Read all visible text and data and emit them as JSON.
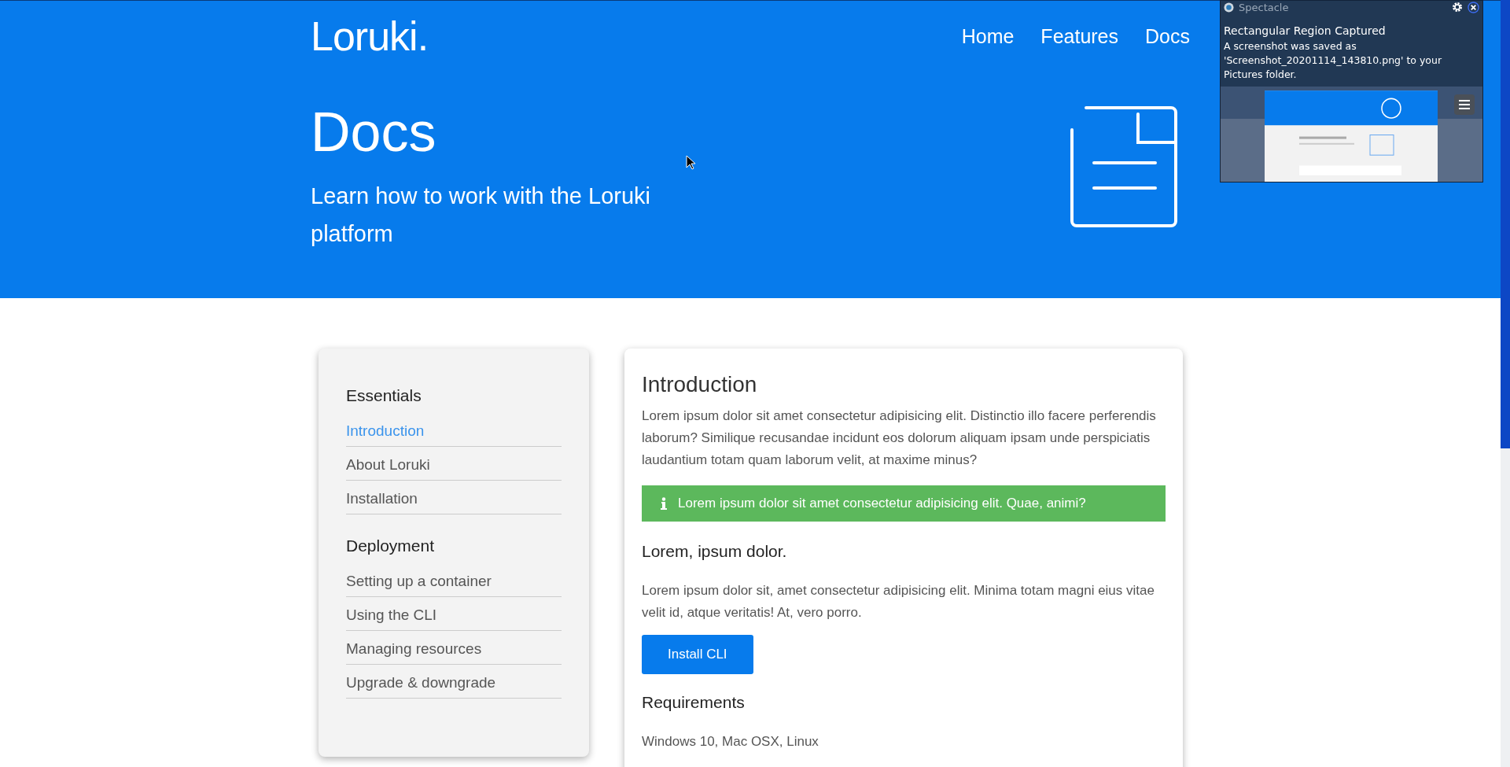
{
  "header": {
    "logo": "Loruki.",
    "nav": [
      "Home",
      "Features",
      "Docs"
    ]
  },
  "hero": {
    "title": "Docs",
    "subtitle": "Learn how to work with the Loruki platform"
  },
  "sidebar": {
    "sections": [
      {
        "heading": "Essentials",
        "items": [
          {
            "label": "Introduction",
            "selected": true
          },
          {
            "label": "About Loruki",
            "selected": false
          },
          {
            "label": "Installation",
            "selected": false
          }
        ]
      },
      {
        "heading": "Deployment",
        "items": [
          {
            "label": "Setting up a container",
            "selected": false
          },
          {
            "label": "Using the CLI",
            "selected": false
          },
          {
            "label": "Managing resources",
            "selected": false
          },
          {
            "label": "Upgrade & downgrade",
            "selected": false
          }
        ]
      }
    ]
  },
  "content": {
    "title": "Introduction",
    "paragraph": "Lorem ipsum dolor sit amet consectetur adipisicing elit. Distinctio illo facere perferendis laborum? Similique recusandae incidunt eos dolorum aliquam ipsam unde perspiciatis laudantium totam quam laborum velit, at maxime minus?",
    "alert": "Lorem ipsum dolor sit amet consectetur adipisicing elit. Quae, animi?",
    "subheading": "Lorem, ipsum dolor.",
    "paragraph_2": "Lorem ipsum dolor sit, amet consectetur adipisicing elit. Minima totam magni eius vitae velit id, atque veritatis! At, vero porro.",
    "button": "Install CLI",
    "requirements_heading": "Requirements",
    "requirements": [
      "Windows 10, Mac OSX, Linux"
    ]
  },
  "notification": {
    "app": "Spectacle",
    "title": "Rectangular Region Captured",
    "body": "A screenshot was saved as 'Screenshot_20201114_143810.png' to your Pictures folder."
  }
}
